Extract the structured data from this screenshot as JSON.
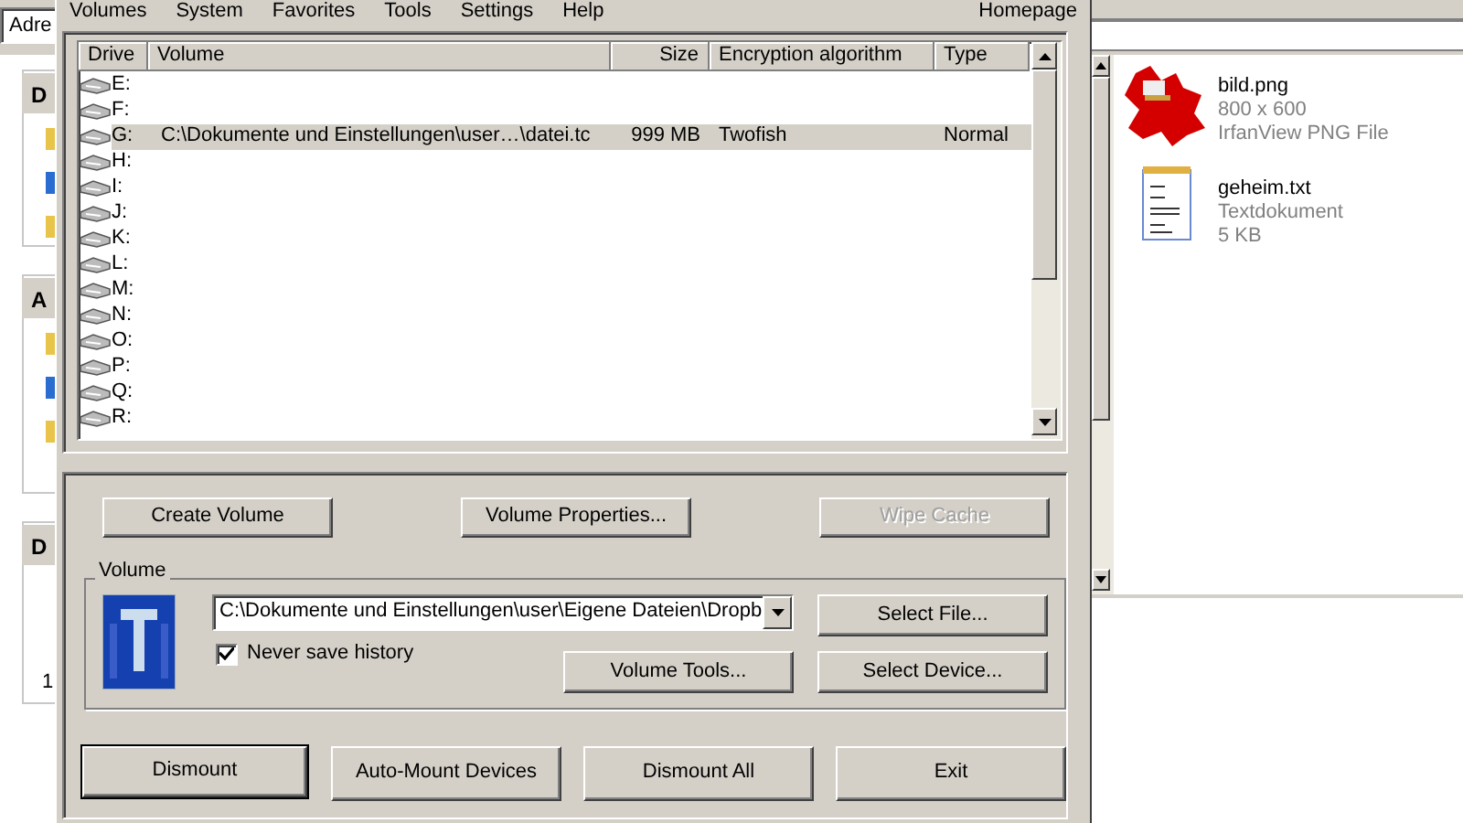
{
  "background_explorer": {
    "address_label": "Adre",
    "panels": [
      {
        "heading": "D"
      },
      {
        "heading": "A"
      },
      {
        "heading": "D",
        "lines": [
          "1"
        ]
      }
    ],
    "files": [
      {
        "kind": "image",
        "name": "bild.png",
        "detail": "800 x 600",
        "type": "IrfanView PNG File"
      },
      {
        "kind": "text",
        "name": "geheim.txt",
        "detail": "Textdokument",
        "type": "5 KB"
      }
    ]
  },
  "menu": [
    "Volumes",
    "System",
    "Favorites",
    "Tools",
    "Settings",
    "Help"
  ],
  "homepage": "Homepage",
  "table": {
    "columns": [
      "Drive",
      "Volume",
      "Size",
      "Encryption algorithm",
      "Type"
    ],
    "rows": [
      {
        "drive": "E:",
        "volume": "",
        "size": "",
        "algorithm": "",
        "type": "",
        "selected": false
      },
      {
        "drive": "F:",
        "volume": "",
        "size": "",
        "algorithm": "",
        "type": "",
        "selected": false
      },
      {
        "drive": "G:",
        "volume": "C:\\Dokumente und Einstellungen\\user…\\datei.tc",
        "size": "999 MB",
        "algorithm": "Twofish",
        "type": "Normal",
        "selected": true
      },
      {
        "drive": "H:",
        "volume": "",
        "size": "",
        "algorithm": "",
        "type": "",
        "selected": false
      },
      {
        "drive": "I:",
        "volume": "",
        "size": "",
        "algorithm": "",
        "type": "",
        "selected": false
      },
      {
        "drive": "J:",
        "volume": "",
        "size": "",
        "algorithm": "",
        "type": "",
        "selected": false
      },
      {
        "drive": "K:",
        "volume": "",
        "size": "",
        "algorithm": "",
        "type": "",
        "selected": false
      },
      {
        "drive": "L:",
        "volume": "",
        "size": "",
        "algorithm": "",
        "type": "",
        "selected": false
      },
      {
        "drive": "M:",
        "volume": "",
        "size": "",
        "algorithm": "",
        "type": "",
        "selected": false
      },
      {
        "drive": "N:",
        "volume": "",
        "size": "",
        "algorithm": "",
        "type": "",
        "selected": false
      },
      {
        "drive": "O:",
        "volume": "",
        "size": "",
        "algorithm": "",
        "type": "",
        "selected": false
      },
      {
        "drive": "P:",
        "volume": "",
        "size": "",
        "algorithm": "",
        "type": "",
        "selected": false
      },
      {
        "drive": "Q:",
        "volume": "",
        "size": "",
        "algorithm": "",
        "type": "",
        "selected": false
      },
      {
        "drive": "R:",
        "volume": "",
        "size": "",
        "algorithm": "",
        "type": "",
        "selected": false
      }
    ]
  },
  "top_buttons": [
    {
      "label": "Create Volume",
      "disabled": false
    },
    {
      "label": "Volume Properties...",
      "disabled": false
    },
    {
      "label": "Wipe Cache",
      "disabled": true
    }
  ],
  "volume_group": {
    "legend": "Volume",
    "path": "C:\\Dokumente und Einstellungen\\user\\Eigene Dateien\\Dropb",
    "never_save_history": {
      "label": "Never save history",
      "checked": true
    },
    "buttons": [
      {
        "label": "Select File..."
      },
      {
        "label": "Volume Tools..."
      },
      {
        "label": "Select Device..."
      }
    ]
  },
  "bottom_buttons": [
    {
      "label": "Dismount",
      "default": true
    },
    {
      "label": "Auto-Mount Devices",
      "default": false
    },
    {
      "label": "Dismount All",
      "default": false
    },
    {
      "label": "Exit",
      "default": false
    }
  ]
}
